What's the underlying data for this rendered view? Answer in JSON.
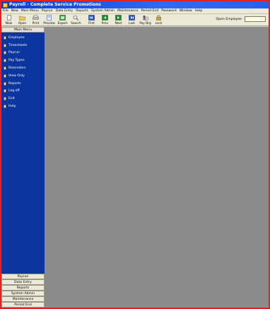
{
  "window": {
    "title": "Payroll - Complete Service Promotions"
  },
  "menubar": {
    "items": [
      "File",
      "New",
      "Main Menu",
      "Payrun",
      "Data Entry",
      "Reports",
      "System Admin",
      "Maintenance",
      "Period End",
      "Password",
      "Window",
      "Help"
    ]
  },
  "toolbar": {
    "buttons": [
      {
        "label": "New",
        "icon": "new-document-icon"
      },
      {
        "label": "Open",
        "icon": "folder-open-icon"
      },
      {
        "label": "Print",
        "icon": "printer-icon"
      },
      {
        "label": "Preview",
        "icon": "preview-icon"
      },
      {
        "label": "Export",
        "icon": "export-icon"
      },
      {
        "label": "Search",
        "icon": "search-icon"
      },
      {
        "label": "First",
        "icon": "first-icon"
      },
      {
        "label": "Prev",
        "icon": "prev-icon"
      },
      {
        "label": "Next",
        "icon": "next-icon"
      },
      {
        "label": "Last",
        "icon": "last-icon"
      },
      {
        "label": "Pay Drg",
        "icon": "pay-drg-icon"
      },
      {
        "label": "Lock",
        "icon": "lock-icon"
      }
    ],
    "open_employee_label": "Open Employee"
  },
  "sidebar": {
    "header": "Main Menu",
    "items": [
      {
        "label": "Employee"
      },
      {
        "label": "Timesheets"
      },
      {
        "label": "Payrun"
      },
      {
        "label": "Pay Types"
      },
      {
        "label": "Reminders"
      },
      {
        "label": "View Only"
      },
      {
        "label": "Reports"
      },
      {
        "label": "Log off"
      },
      {
        "label": "Exit"
      },
      {
        "label": "Help"
      }
    ],
    "tabs": [
      "Payrun",
      "Data Entry",
      "Reports",
      "System Admin",
      "Maintenance",
      "Period End"
    ]
  }
}
